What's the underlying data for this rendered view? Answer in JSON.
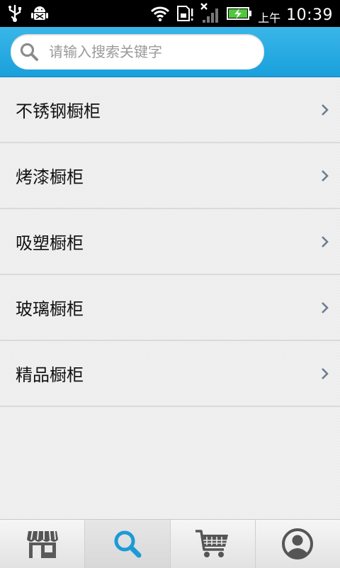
{
  "status_bar": {
    "ampm": "上午",
    "time": "10:39",
    "icons": [
      "usb-icon",
      "android-debug-icon",
      "wifi-icon",
      "sd-card-icon",
      "no-signal-icon",
      "battery-charging-icon"
    ]
  },
  "search": {
    "placeholder": "请输入搜索关键字",
    "value": ""
  },
  "categories": [
    {
      "label": "不锈钢橱柜"
    },
    {
      "label": "烤漆橱柜"
    },
    {
      "label": "吸塑橱柜"
    },
    {
      "label": "玻璃橱柜"
    },
    {
      "label": "精品橱柜"
    }
  ],
  "tabbar": {
    "tabs": [
      {
        "icon": "store-icon",
        "active": false
      },
      {
        "icon": "search-icon",
        "active": true
      },
      {
        "icon": "shopping-cart-icon",
        "active": false
      },
      {
        "icon": "user-account-icon",
        "active": false
      }
    ]
  },
  "colors": {
    "header": "#1aa0dc",
    "accent": "#1a9bd7",
    "chevron": "#6b7d8f"
  }
}
